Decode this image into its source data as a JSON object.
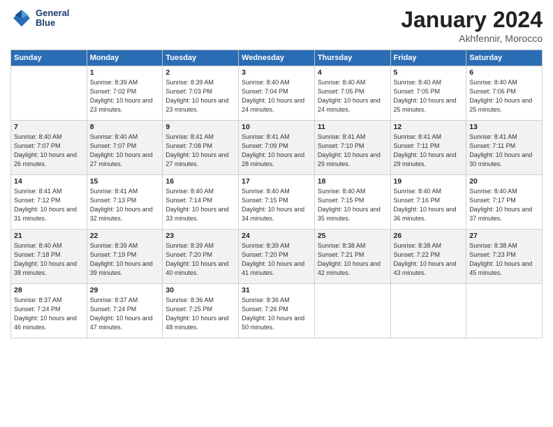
{
  "header": {
    "logo_line1": "General",
    "logo_line2": "Blue",
    "month_title": "January 2024",
    "location": "Akhfennir, Morocco"
  },
  "days_of_week": [
    "Sunday",
    "Monday",
    "Tuesday",
    "Wednesday",
    "Thursday",
    "Friday",
    "Saturday"
  ],
  "weeks": [
    [
      {
        "day": "",
        "sunrise": "",
        "sunset": "",
        "daylight": ""
      },
      {
        "day": "1",
        "sunrise": "Sunrise: 8:39 AM",
        "sunset": "Sunset: 7:02 PM",
        "daylight": "Daylight: 10 hours and 23 minutes."
      },
      {
        "day": "2",
        "sunrise": "Sunrise: 8:39 AM",
        "sunset": "Sunset: 7:03 PM",
        "daylight": "Daylight: 10 hours and 23 minutes."
      },
      {
        "day": "3",
        "sunrise": "Sunrise: 8:40 AM",
        "sunset": "Sunset: 7:04 PM",
        "daylight": "Daylight: 10 hours and 24 minutes."
      },
      {
        "day": "4",
        "sunrise": "Sunrise: 8:40 AM",
        "sunset": "Sunset: 7:05 PM",
        "daylight": "Daylight: 10 hours and 24 minutes."
      },
      {
        "day": "5",
        "sunrise": "Sunrise: 8:40 AM",
        "sunset": "Sunset: 7:05 PM",
        "daylight": "Daylight: 10 hours and 25 minutes."
      },
      {
        "day": "6",
        "sunrise": "Sunrise: 8:40 AM",
        "sunset": "Sunset: 7:06 PM",
        "daylight": "Daylight: 10 hours and 25 minutes."
      }
    ],
    [
      {
        "day": "7",
        "sunrise": "Sunrise: 8:40 AM",
        "sunset": "Sunset: 7:07 PM",
        "daylight": "Daylight: 10 hours and 26 minutes."
      },
      {
        "day": "8",
        "sunrise": "Sunrise: 8:40 AM",
        "sunset": "Sunset: 7:07 PM",
        "daylight": "Daylight: 10 hours and 27 minutes."
      },
      {
        "day": "9",
        "sunrise": "Sunrise: 8:41 AM",
        "sunset": "Sunset: 7:08 PM",
        "daylight": "Daylight: 10 hours and 27 minutes."
      },
      {
        "day": "10",
        "sunrise": "Sunrise: 8:41 AM",
        "sunset": "Sunset: 7:09 PM",
        "daylight": "Daylight: 10 hours and 28 minutes."
      },
      {
        "day": "11",
        "sunrise": "Sunrise: 8:41 AM",
        "sunset": "Sunset: 7:10 PM",
        "daylight": "Daylight: 10 hours and 29 minutes."
      },
      {
        "day": "12",
        "sunrise": "Sunrise: 8:41 AM",
        "sunset": "Sunset: 7:11 PM",
        "daylight": "Daylight: 10 hours and 29 minutes."
      },
      {
        "day": "13",
        "sunrise": "Sunrise: 8:41 AM",
        "sunset": "Sunset: 7:11 PM",
        "daylight": "Daylight: 10 hours and 30 minutes."
      }
    ],
    [
      {
        "day": "14",
        "sunrise": "Sunrise: 8:41 AM",
        "sunset": "Sunset: 7:12 PM",
        "daylight": "Daylight: 10 hours and 31 minutes."
      },
      {
        "day": "15",
        "sunrise": "Sunrise: 8:41 AM",
        "sunset": "Sunset: 7:13 PM",
        "daylight": "Daylight: 10 hours and 32 minutes."
      },
      {
        "day": "16",
        "sunrise": "Sunrise: 8:40 AM",
        "sunset": "Sunset: 7:14 PM",
        "daylight": "Daylight: 10 hours and 33 minutes."
      },
      {
        "day": "17",
        "sunrise": "Sunrise: 8:40 AM",
        "sunset": "Sunset: 7:15 PM",
        "daylight": "Daylight: 10 hours and 34 minutes."
      },
      {
        "day": "18",
        "sunrise": "Sunrise: 8:40 AM",
        "sunset": "Sunset: 7:15 PM",
        "daylight": "Daylight: 10 hours and 35 minutes."
      },
      {
        "day": "19",
        "sunrise": "Sunrise: 8:40 AM",
        "sunset": "Sunset: 7:16 PM",
        "daylight": "Daylight: 10 hours and 36 minutes."
      },
      {
        "day": "20",
        "sunrise": "Sunrise: 8:40 AM",
        "sunset": "Sunset: 7:17 PM",
        "daylight": "Daylight: 10 hours and 37 minutes."
      }
    ],
    [
      {
        "day": "21",
        "sunrise": "Sunrise: 8:40 AM",
        "sunset": "Sunset: 7:18 PM",
        "daylight": "Daylight: 10 hours and 38 minutes."
      },
      {
        "day": "22",
        "sunrise": "Sunrise: 8:39 AM",
        "sunset": "Sunset: 7:19 PM",
        "daylight": "Daylight: 10 hours and 39 minutes."
      },
      {
        "day": "23",
        "sunrise": "Sunrise: 8:39 AM",
        "sunset": "Sunset: 7:20 PM",
        "daylight": "Daylight: 10 hours and 40 minutes."
      },
      {
        "day": "24",
        "sunrise": "Sunrise: 8:39 AM",
        "sunset": "Sunset: 7:20 PM",
        "daylight": "Daylight: 10 hours and 41 minutes."
      },
      {
        "day": "25",
        "sunrise": "Sunrise: 8:38 AM",
        "sunset": "Sunset: 7:21 PM",
        "daylight": "Daylight: 10 hours and 42 minutes."
      },
      {
        "day": "26",
        "sunrise": "Sunrise: 8:38 AM",
        "sunset": "Sunset: 7:22 PM",
        "daylight": "Daylight: 10 hours and 43 minutes."
      },
      {
        "day": "27",
        "sunrise": "Sunrise: 8:38 AM",
        "sunset": "Sunset: 7:23 PM",
        "daylight": "Daylight: 10 hours and 45 minutes."
      }
    ],
    [
      {
        "day": "28",
        "sunrise": "Sunrise: 8:37 AM",
        "sunset": "Sunset: 7:24 PM",
        "daylight": "Daylight: 10 hours and 46 minutes."
      },
      {
        "day": "29",
        "sunrise": "Sunrise: 8:37 AM",
        "sunset": "Sunset: 7:24 PM",
        "daylight": "Daylight: 10 hours and 47 minutes."
      },
      {
        "day": "30",
        "sunrise": "Sunrise: 8:36 AM",
        "sunset": "Sunset: 7:25 PM",
        "daylight": "Daylight: 10 hours and 48 minutes."
      },
      {
        "day": "31",
        "sunrise": "Sunrise: 8:36 AM",
        "sunset": "Sunset: 7:26 PM",
        "daylight": "Daylight: 10 hours and 50 minutes."
      },
      {
        "day": "",
        "sunrise": "",
        "sunset": "",
        "daylight": ""
      },
      {
        "day": "",
        "sunrise": "",
        "sunset": "",
        "daylight": ""
      },
      {
        "day": "",
        "sunrise": "",
        "sunset": "",
        "daylight": ""
      }
    ]
  ]
}
